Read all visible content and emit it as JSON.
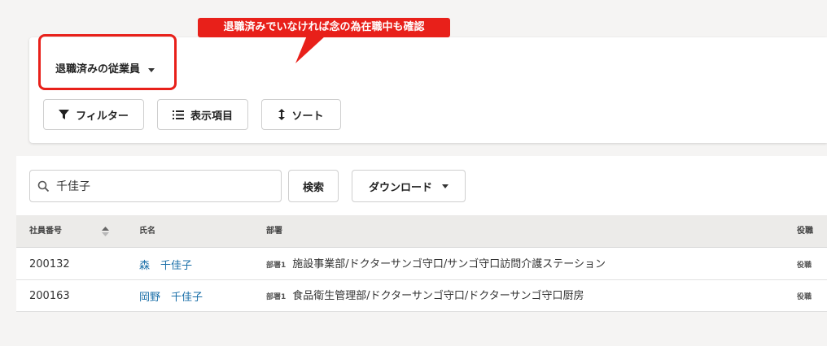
{
  "view": {
    "label": "退職済みの従業員"
  },
  "callout": {
    "text": "退職済みでいなければ念の為在職中も確認"
  },
  "toolbar": {
    "filter_label": "フィルター",
    "columns_label": "表示項目",
    "sort_label": "ソート"
  },
  "search": {
    "value": "千佳子",
    "button_label": "検索",
    "download_label": "ダウンロード"
  },
  "table": {
    "headers": {
      "employee_no": "社員番号",
      "name": "氏名",
      "department": "部署",
      "role": "役職"
    },
    "rows": [
      {
        "employee_no": "200132",
        "name": "森　千佳子",
        "dept_tag": "部署1",
        "department": "施設事業部/ドクターサンゴ守口/サンゴ守口訪問介護ステーション",
        "role": "役職"
      },
      {
        "employee_no": "200163",
        "name": "岡野　千佳子",
        "dept_tag": "部署1",
        "department": "食品衛生管理部/ドクターサンゴ守口/ドクターサンゴ守口厨房",
        "role": "役職"
      }
    ]
  },
  "colors": {
    "accent_red": "#e8201a",
    "link_blue": "#1a6fa8"
  }
}
